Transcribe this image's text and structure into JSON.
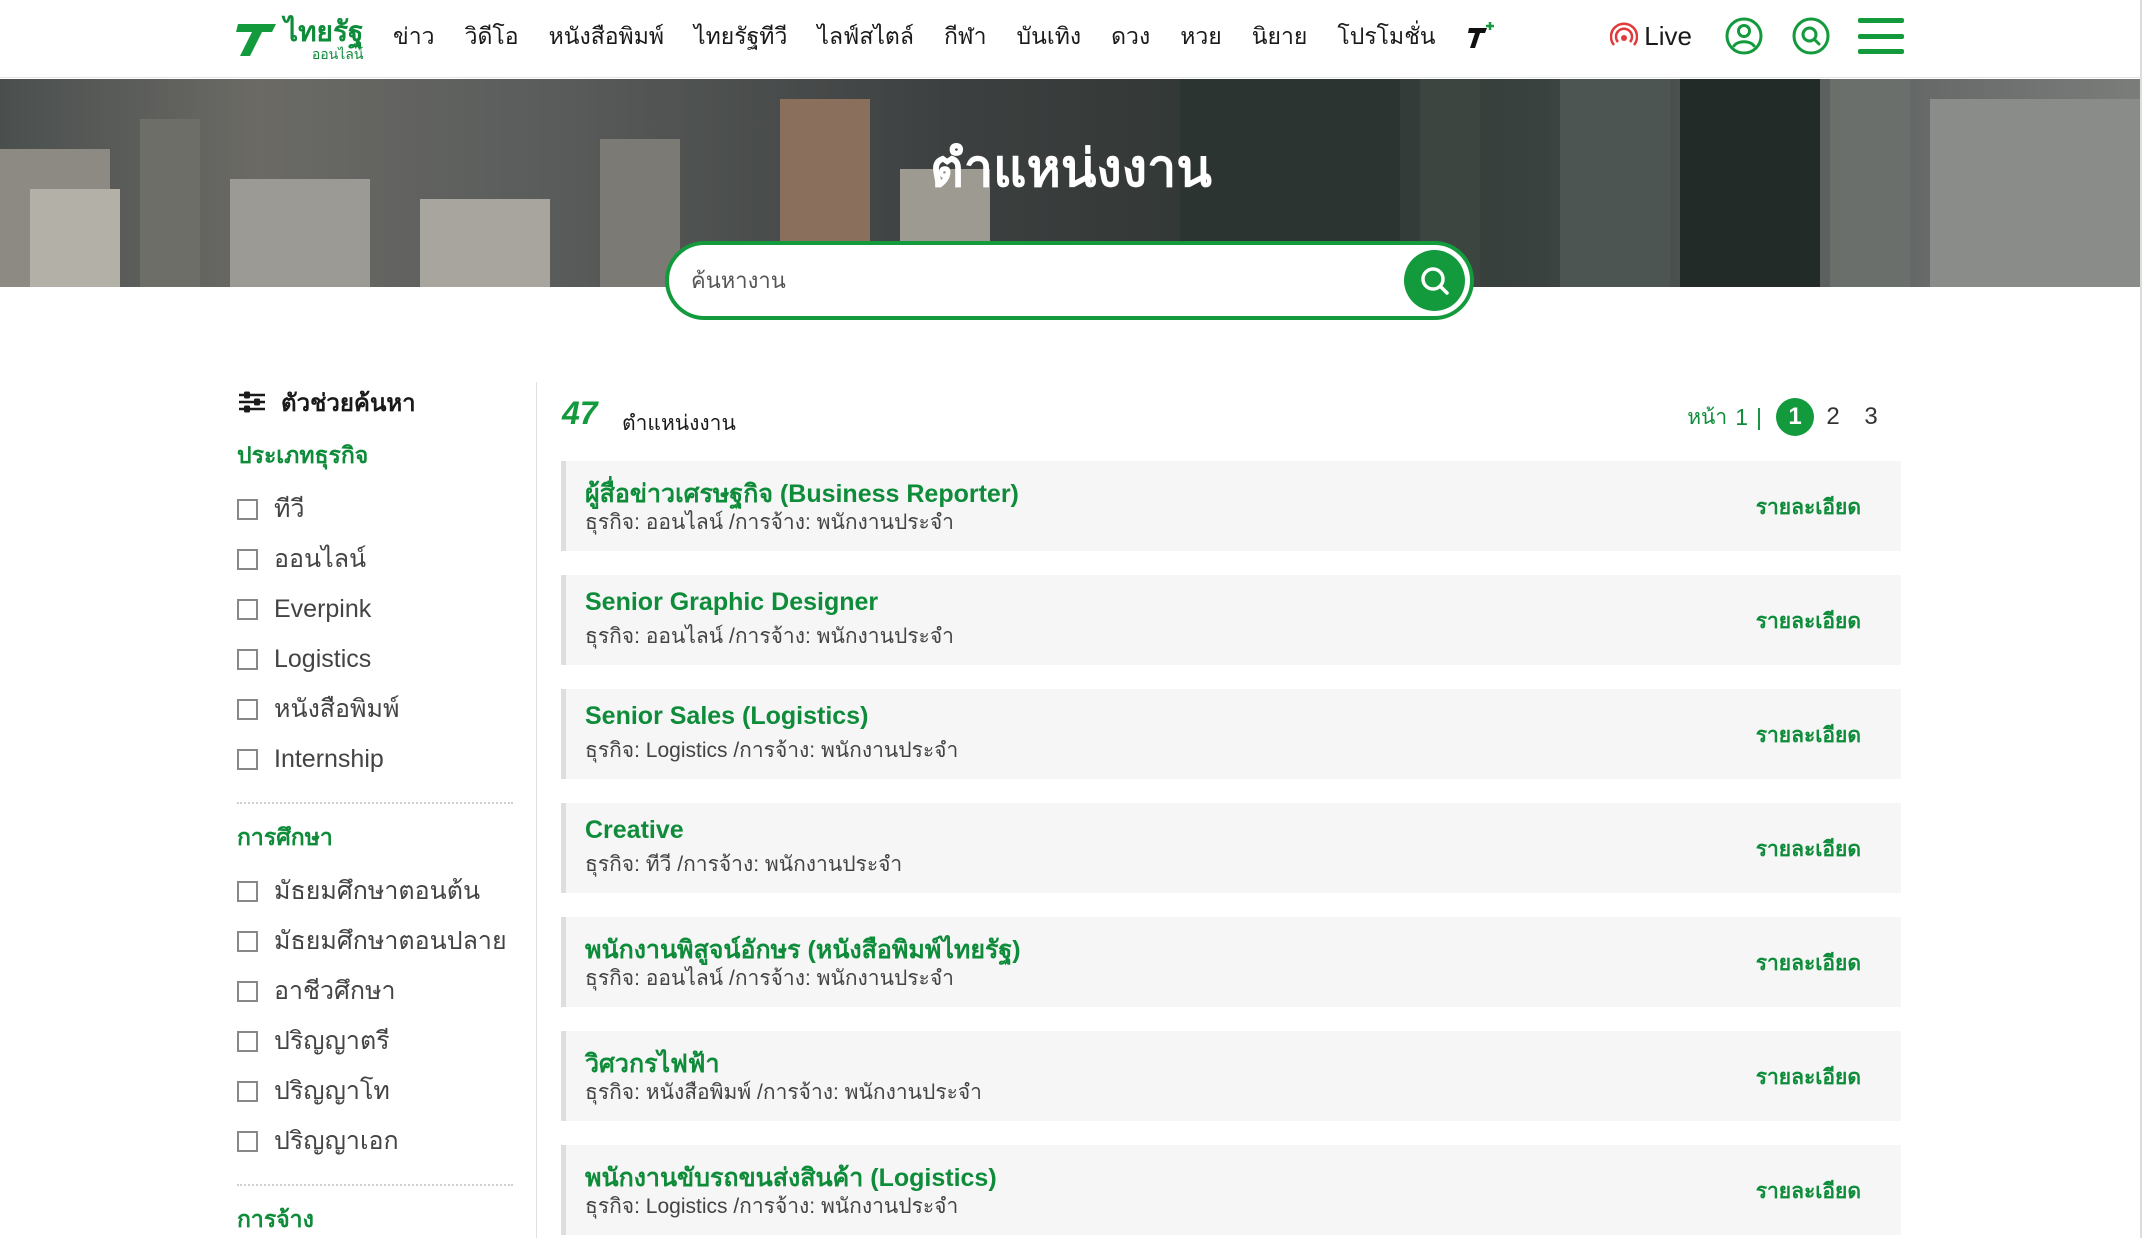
{
  "header": {
    "logo_main": "ไทยรัฐ",
    "logo_sub": "ออนไลน์",
    "nav": [
      "ข่าว",
      "วิดีโอ",
      "หนังสือพิมพ์",
      "ไทยรัฐทีวี",
      "ไลฟ์สไตล์",
      "กีฬา",
      "บันเทิง",
      "ดวง",
      "หวย",
      "นิยาย",
      "โปรโมชั่น"
    ],
    "live_label": "Live",
    "brand_color": "#139a3c"
  },
  "hero": {
    "title": "ตำแหน่งงาน",
    "search_placeholder": "ค้นหางาน"
  },
  "sidebar": {
    "heading": "ตัวช่วยค้นหา",
    "business_title": "ประเภทธุรกิจ",
    "business_items": [
      "ทีวี",
      "ออนไลน์",
      "Everpink",
      "Logistics",
      "หนังสือพิมพ์",
      "Internship"
    ],
    "education_title": "การศึกษา",
    "education_items": [
      "มัธยมศึกษาตอนต้น",
      "มัธยมศึกษาตอนปลาย",
      "อาชีวศึกษา",
      "ปริญญาตรี",
      "ปริญญาโท",
      "ปริญญาเอก"
    ],
    "employment_title": "การจ้าง"
  },
  "results": {
    "count": "47",
    "count_label": "ตำแหน่งงาน",
    "page_label": "หน้า",
    "current_page": "1",
    "separator": "|",
    "pages": [
      "1",
      "2",
      "3"
    ]
  },
  "jobs": [
    {
      "title": "ผู้สื่อข่าวเศรษฐกิจ (Business Reporter)",
      "meta": "ธุรกิจ: ออนไลน์ /การจ้าง: พนักงานประจำ",
      "detail": "รายละเอียด"
    },
    {
      "title": "Senior Graphic Designer",
      "meta": "ธุรกิจ: ออนไลน์ /การจ้าง: พนักงานประจำ",
      "detail": "รายละเอียด"
    },
    {
      "title": "Senior Sales (Logistics)",
      "meta": "ธุรกิจ: Logistics /การจ้าง: พนักงานประจำ",
      "detail": "รายละเอียด"
    },
    {
      "title": "Creative",
      "meta": "ธุรกิจ: ทีวี /การจ้าง: พนักงานประจำ",
      "detail": "รายละเอียด"
    },
    {
      "title": "พนักงานพิสูจน์อักษร (หนังสือพิมพ์ไทยรัฐ)",
      "meta": "ธุรกิจ: ออนไลน์ /การจ้าง: พนักงานประจำ",
      "detail": "รายละเอียด"
    },
    {
      "title": "วิศวกรไฟฟ้า",
      "meta": "ธุรกิจ: หนังสือพิมพ์ /การจ้าง: พนักงานประจำ",
      "detail": "รายละเอียด"
    },
    {
      "title": "พนักงานขับรถขนส่งสินค้า (Logistics)",
      "meta": "ธุรกิจ: Logistics /การจ้าง: พนักงานประจำ",
      "detail": "รายละเอียด"
    }
  ]
}
